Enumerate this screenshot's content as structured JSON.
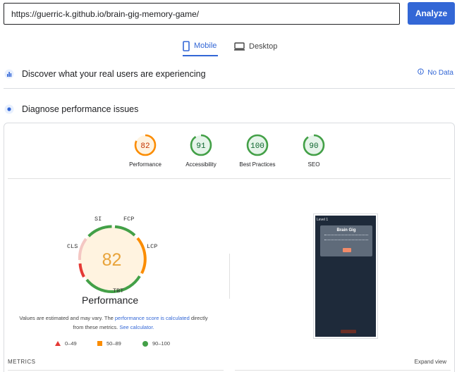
{
  "search": {
    "url": "https://guerric-k.github.io/brain-gig-memory-game/",
    "analyze_label": "Analyze"
  },
  "tabs": {
    "mobile": "Mobile",
    "desktop": "Desktop"
  },
  "crux": {
    "title": "Discover what your real users are experiencing",
    "nodata": "No Data"
  },
  "diagnose": {
    "title": "Diagnose performance issues"
  },
  "categories": [
    {
      "score": "82",
      "label": "Performance",
      "color": "#fb8c00"
    },
    {
      "score": "91",
      "label": "Accessibility",
      "color": "#43a047"
    },
    {
      "score": "100",
      "label": "Best Practices",
      "color": "#43a047"
    },
    {
      "score": "90",
      "label": "SEO",
      "color": "#43a047"
    }
  ],
  "gauge": {
    "score": "82",
    "title": "Performance",
    "metrics": {
      "si": "SI",
      "fcp": "FCP",
      "lcp": "LCP",
      "tbt": "TBT",
      "cls": "CLS"
    }
  },
  "note": {
    "prefix": "Values are estimated and may vary. The ",
    "link1": "performance score is calculated",
    "middle": " directly from these metrics. ",
    "link2": "See calculator."
  },
  "legend": {
    "fail": "0–49",
    "average": "50–89",
    "pass": "90–100"
  },
  "metrics_label": "METRICS",
  "expand_label": "Expand view",
  "phone": {
    "level": "Level 1",
    "modal_title": "Brain Gig"
  }
}
